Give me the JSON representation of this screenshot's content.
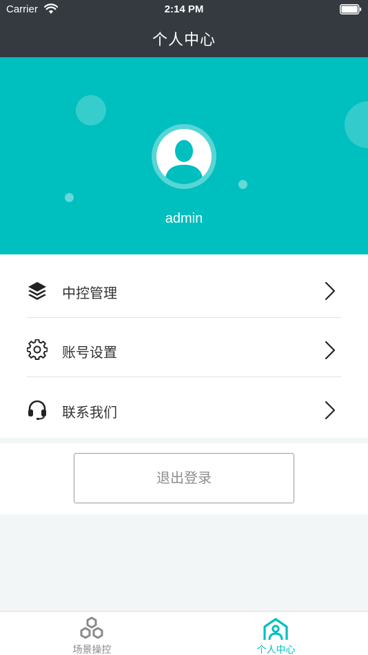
{
  "status_bar": {
    "carrier": "Carrier",
    "time": "2:14 PM"
  },
  "nav": {
    "title": "个人中心"
  },
  "profile": {
    "username": "admin"
  },
  "menu": {
    "items": [
      {
        "label": "中控管理",
        "icon": "layers-icon"
      },
      {
        "label": "账号设置",
        "icon": "gear-icon"
      },
      {
        "label": "联系我们",
        "icon": "headset-icon"
      }
    ]
  },
  "logout": {
    "label": "退出登录"
  },
  "tabs": [
    {
      "label": "场景操控",
      "icon": "hexagons-icon",
      "active": false
    },
    {
      "label": "个人中心",
      "icon": "home-person-icon",
      "active": true
    }
  ],
  "colors": {
    "accent": "#00bfbf",
    "nav_background": "#343a40",
    "inactive_tab": "#8a8a8a"
  }
}
